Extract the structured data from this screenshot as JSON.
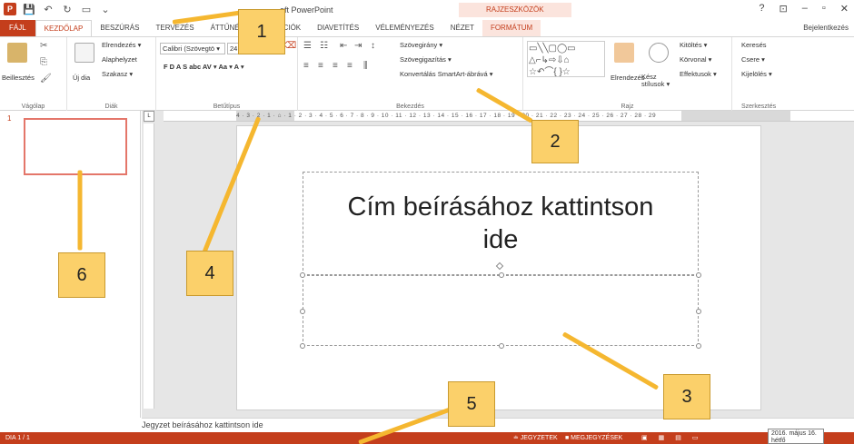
{
  "titlebar": {
    "app_icon": "P",
    "title": "oft PowerPoint",
    "context_group": "RAJZESZKÖZÖK",
    "help": "?",
    "controls": [
      "⊡",
      "–",
      "▫",
      "✕"
    ]
  },
  "tabs": {
    "file": "FÁJL",
    "home": "KEZDŐLAP",
    "insert": "BESZÚRÁS",
    "design": "TERVEZÉS",
    "transitions": "ÁTTŰNÉ",
    "animations": "CIÓK",
    "slideshow": "DIAVETÍTÉS",
    "review": "VÉLEMÉNYEZÉS",
    "view": "NÉZET",
    "format": "FORMÁTUM",
    "signin": "Bejelentkezés"
  },
  "ribbon": {
    "clipboard": {
      "label": "Vágólap",
      "paste": "Beillesztés"
    },
    "slides": {
      "label": "Diák",
      "new_slide": "Új dia",
      "layout": "Elrendezés ▾",
      "reset": "Alaphelyzet",
      "section": "Szakasz ▾"
    },
    "font": {
      "label": "Betűtípus",
      "font_name": "Calibri (Szövegtö ▾",
      "font_size": "24 ▾",
      "grow": "A˄",
      "shrink": "A˅",
      "format_row": "F  D  A  S  abc  AV ▾  Aa ▾   A ▾"
    },
    "paragraph": {
      "label": "Bekezdés",
      "text_direction": "Szövegirány ▾",
      "align_text": "Szövegigazítás ▾",
      "convert_smartart": "Konvertálás SmartArt-ábrává ▾"
    },
    "drawing": {
      "label": "Rajz",
      "arrange": "Elrendezés",
      "quick_styles": "Kész stílusok ▾",
      "fill": "Kitöltés ▾",
      "outline": "Körvonal ▾",
      "effects": "Effektusok ▾"
    },
    "editing": {
      "label": "Szerkesztés",
      "find": "Keresés",
      "replace": "Csere ▾",
      "select": "Kijelölés ▾"
    }
  },
  "thumbnails": {
    "slide_number": "1"
  },
  "ruler": {
    "ticks": "4 · 3 · 2 · 1 · ⌂ · 1 · 2 · 3 · 4 · 5 · 6 · 7 · 8 · 9 · 10 · 11 · 12 · 13 · 14 · 15 · 16 · 17 · 18 · 19 · 20 · 21 · 22 · 23 · 24 · 25 · 26 · 27 · 28 · 29"
  },
  "slide": {
    "title_placeholder": "Cím beírásához kattintson ide"
  },
  "notes": {
    "placeholder": "Jegyzet beírásához kattintson ide"
  },
  "status": {
    "slide_info": "DIA 1 / 1",
    "notes_button": "≐ JEGYZETEK",
    "comments_button": "■ MEGJEGYZÉSEK",
    "date_tooltip_line1": "2016. május 16.",
    "date_tooltip_line2": "hétfő"
  },
  "callouts": {
    "c1": "1",
    "c2": "2",
    "c3": "3",
    "c4": "4",
    "c5": "5",
    "c6": "6"
  },
  "colors": {
    "accent": "#c43e1c",
    "callout": "#fbd06a"
  }
}
